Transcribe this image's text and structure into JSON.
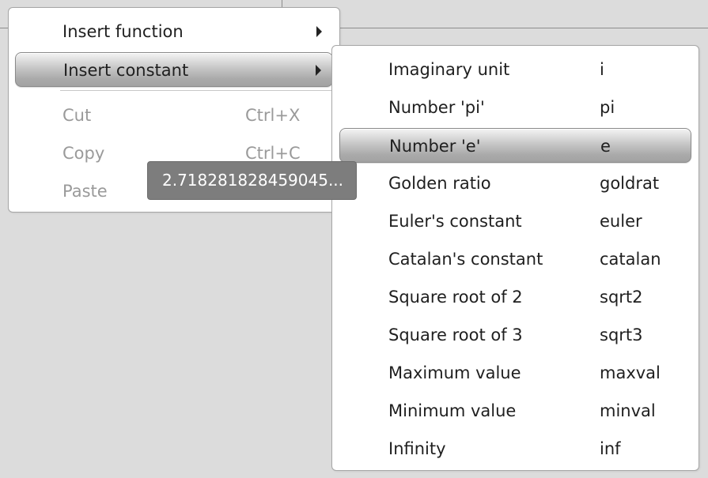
{
  "main_menu": {
    "insert_function": "Insert function",
    "insert_constant": "Insert constant",
    "cut": {
      "label": "Cut",
      "shortcut": "Ctrl+X"
    },
    "copy": {
      "label": "Copy",
      "shortcut": "Ctrl+C"
    },
    "paste": {
      "label": "Paste"
    }
  },
  "submenu": {
    "items": [
      {
        "label": "Imaginary unit",
        "value": "i"
      },
      {
        "label": "Number 'pi'",
        "value": "pi"
      },
      {
        "label": "Number 'e'",
        "value": "e"
      },
      {
        "label": "Golden ratio",
        "value": "goldrat"
      },
      {
        "label": "Euler's constant",
        "value": "euler"
      },
      {
        "label": "Catalan's constant",
        "value": "catalan"
      },
      {
        "label": "Square root of 2",
        "value": "sqrt2"
      },
      {
        "label": "Square root of 3",
        "value": "sqrt3"
      },
      {
        "label": "Maximum value",
        "value": "maxval"
      },
      {
        "label": "Minimum value",
        "value": "minval"
      },
      {
        "label": "Infinity",
        "value": "inf"
      }
    ]
  },
  "tooltip": {
    "text": "2.718281828459045..."
  },
  "colors": {
    "background": "#dcdcdc",
    "menu": "#ffffff",
    "highlight": "#b4b4b4",
    "tooltip": "#7d7d7d",
    "disabled_text": "#9a9a9a"
  },
  "icons": {
    "submenu_arrow": "triangle-right-icon"
  }
}
